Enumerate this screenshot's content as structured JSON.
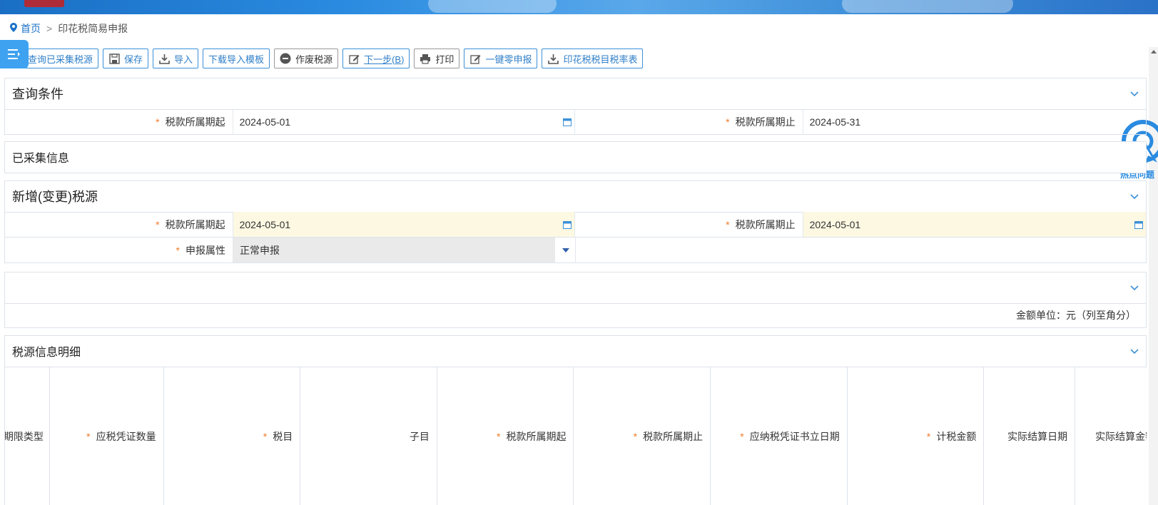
{
  "breadcrumb": {
    "home": "首页",
    "separator": ">",
    "current": "印花税简易申报"
  },
  "toolbar": {
    "buttons": [
      {
        "label": "查询已采集税源",
        "icon": "none"
      },
      {
        "label": "保存",
        "icon": "save-icon"
      },
      {
        "label": "导入",
        "icon": "import-icon"
      },
      {
        "label": "下载导入模板",
        "icon": "none"
      },
      {
        "label": "作废税源",
        "icon": "void-icon"
      },
      {
        "label": "下一步(B)",
        "icon": "edit-icon"
      },
      {
        "label": "打印",
        "icon": "print-icon"
      },
      {
        "label": "一键零申报",
        "icon": "edit-icon"
      },
      {
        "label": "印花税税目税率表",
        "icon": "download-icon"
      }
    ]
  },
  "hot_questions": {
    "label": "热点问题"
  },
  "query_panel": {
    "title": "查询条件",
    "start_label": "税款所属期起",
    "start_value": "2024-05-01",
    "end_label": "税款所属期止",
    "end_value": "2024-05-31"
  },
  "collected_panel": {
    "title": "已采集信息"
  },
  "new_source_panel": {
    "title": "新增(变更)税源",
    "start_label": "税款所属期起",
    "start_value": "2024-05-01",
    "end_label": "税款所属期止",
    "end_value": "2024-05-01",
    "attr_label": "申报属性",
    "attr_value": "正常申报"
  },
  "amount_unit": "金额单位：元（列至角分）",
  "detail_panel": {
    "title": "税源信息明细",
    "columns": [
      {
        "label": "期限类型",
        "required": false
      },
      {
        "label": "应税凭证数量",
        "required": true
      },
      {
        "label": "税目",
        "required": true
      },
      {
        "label": "子目",
        "required": false
      },
      {
        "label": "税款所属期起",
        "required": true
      },
      {
        "label": "税款所属期止",
        "required": true
      },
      {
        "label": "应纳税凭证书立日期",
        "required": true
      },
      {
        "label": "计税金额",
        "required": true
      },
      {
        "label": "实际结算日期",
        "required": false
      },
      {
        "label": "实际结算金额",
        "required": false
      }
    ]
  },
  "required_mark": "*",
  "colors": {
    "accent": "#2f7fc8",
    "required": "#f07a2a",
    "highlight": "#fdf8e2"
  }
}
